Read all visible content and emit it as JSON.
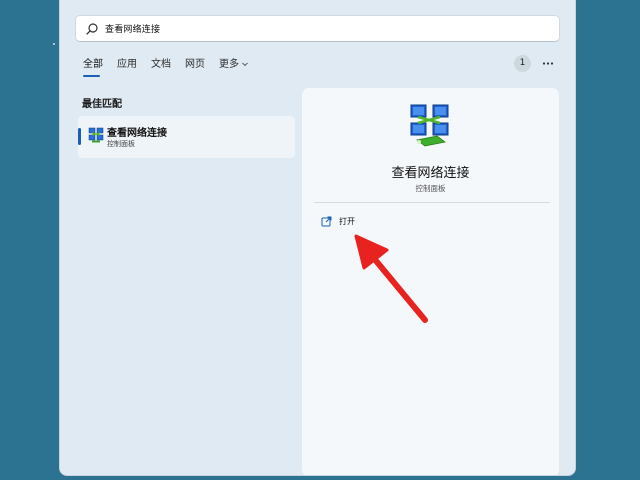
{
  "search": {
    "query": "查看网络连接",
    "icon": "search-icon"
  },
  "tabs": [
    {
      "label": "全部",
      "active": true
    },
    {
      "label": "应用",
      "active": false
    },
    {
      "label": "文档",
      "active": false
    },
    {
      "label": "网页",
      "active": false
    },
    {
      "label": "更多",
      "active": false
    }
  ],
  "header": {
    "badge": "1",
    "more_icon": "ellipsis-icon"
  },
  "best_match": {
    "section_title": "最佳匹配",
    "result": {
      "title": "查看网络连接",
      "subtitle": "控制面板",
      "icon": "network-connections-icon"
    }
  },
  "detail": {
    "title": "查看网络连接",
    "subtitle": "控制面板",
    "icon": "network-connections-icon",
    "actions": [
      {
        "label": "打开",
        "icon": "open-external-icon"
      }
    ]
  },
  "colors": {
    "desktop": "#2b7391",
    "panel": "#dfeaf2",
    "accent": "#1a5fb4",
    "annotation_arrow": "#e8231f"
  }
}
